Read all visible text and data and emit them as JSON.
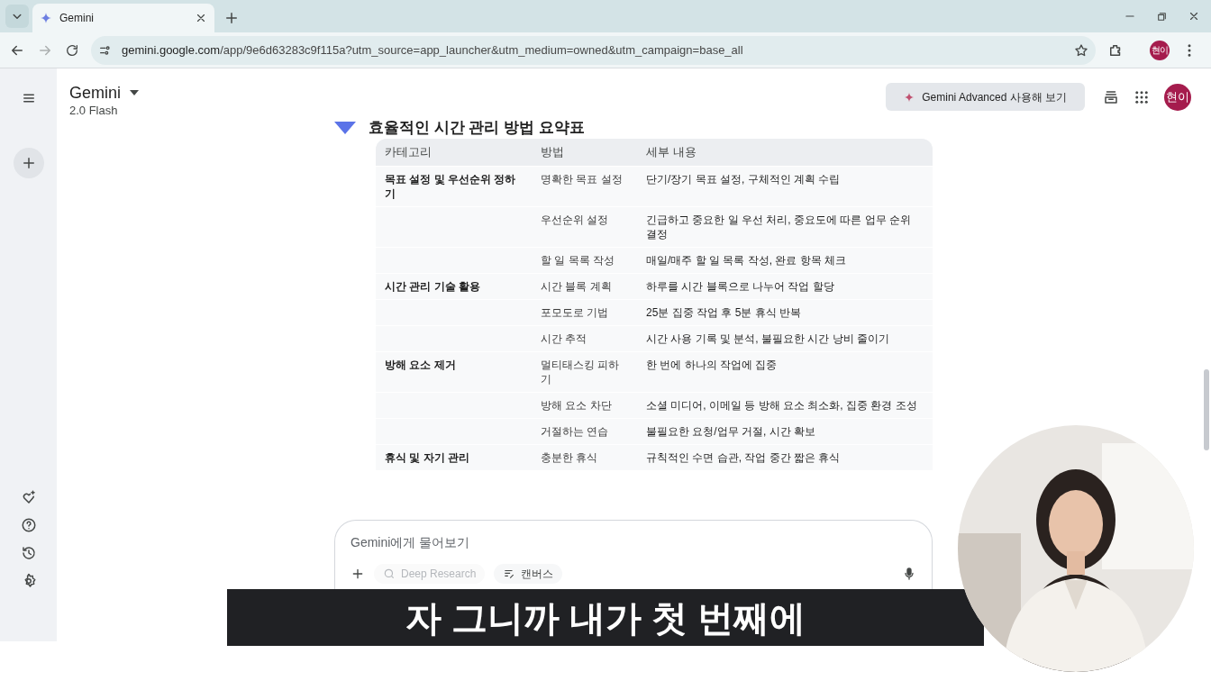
{
  "browser": {
    "tabs": [
      {
        "title": "Gemini",
        "selected": true
      }
    ],
    "url_host": "gemini.google.com",
    "url_path": "/app/9e6d63283c9f115a?utm_source=app_launcher&utm_medium=owned&utm_campaign=base_all",
    "profile": "현이"
  },
  "header": {
    "title": "Gemini",
    "model": "2.0 Flash",
    "upgrade_button": "Gemini Advanced 사용해 보기",
    "avatar": "현이"
  },
  "response": {
    "heading": "효율적인 시간 관리 방법 요약표",
    "table": {
      "columns": [
        "카테고리",
        "방법",
        "세부 내용"
      ],
      "rows": [
        {
          "category": "목표 설정 및 우선순위 정하기",
          "method": "명확한 목표 설정",
          "detail": "단기/장기 목표 설정, 구체적인 계획 수립"
        },
        {
          "category": "",
          "method": "우선순위 설정",
          "detail": "긴급하고 중요한 일 우선 처리, 중요도에 따른 업무 순위 결정"
        },
        {
          "category": "",
          "method": "할 일 목록 작성",
          "detail": "매일/매주 할 일 목록 작성, 완료 항목 체크"
        },
        {
          "category": "시간 관리 기술 활용",
          "method": "시간 블록 계획",
          "detail": "하루를 시간 블록으로 나누어 작업 할당"
        },
        {
          "category": "",
          "method": "포모도로 기법",
          "detail": "25분 집중 작업 후 5분 휴식 반복"
        },
        {
          "category": "",
          "method": "시간 추적",
          "detail": "시간 사용 기록 및 분석, 불필요한 시간 낭비 줄이기"
        },
        {
          "category": "방해 요소 제거",
          "method": "멀티태스킹 피하기",
          "detail": "한 번에 하나의 작업에 집중"
        },
        {
          "category": "",
          "method": "방해 요소 차단",
          "detail": "소셜 미디어, 이메일 등 방해 요소 최소화, 집중 환경 조성"
        },
        {
          "category": "",
          "method": "거절하는 연습",
          "detail": "불필요한 요청/업무 거절, 시간 확보"
        },
        {
          "category": "휴식 및 자기 관리",
          "method": "충분한 휴식",
          "detail": "규칙적인 수면 습관, 작업 중간 짧은 휴식"
        }
      ]
    }
  },
  "prompt": {
    "placeholder": "Gemini에게 물어보기",
    "tools": [
      {
        "label": "Deep Research",
        "disabled": true
      },
      {
        "label": "캔버스",
        "disabled": false
      }
    ]
  },
  "subtitle": "자 그니까 내가 첫 번째에"
}
